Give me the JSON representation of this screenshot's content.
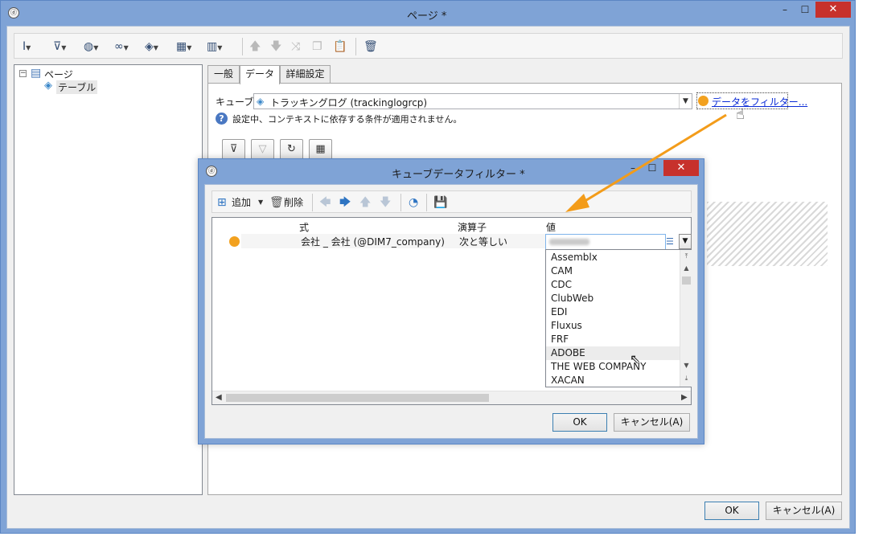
{
  "main_window": {
    "title": "ページ *",
    "logo": "ⓓ",
    "controls": {
      "minimize": "–",
      "maximize": "☐",
      "close": "✕"
    }
  },
  "toolbar": {
    "icons": [
      "insert-icon",
      "filter-add-icon",
      "globe-icon",
      "link-icon",
      "cube-icon",
      "table-icon",
      "columns-icon",
      "move-up-icon",
      "move-down-icon",
      "shuffle-icon",
      "copy-icon",
      "paste-icon",
      "delete-icon"
    ]
  },
  "tree": {
    "root_label": "ページ",
    "child_label": "テーブル",
    "expander": "⊟"
  },
  "tabs": [
    {
      "label": "一般",
      "active": false
    },
    {
      "label": "データ",
      "active": true
    },
    {
      "label": "詳細設定",
      "active": false
    }
  ],
  "data_tab": {
    "cube_label": "キューブ:",
    "cube_value": "トラッキングログ (trackinglogrcp)",
    "filter_link": "データをフィルター...",
    "info_text": "設定中、コンテキストに依存する条件が適用されません。",
    "help_glyph": "?"
  },
  "main_buttons": {
    "ok": "OK",
    "cancel": "キャンセル(A)"
  },
  "dialog": {
    "title": "キューブデータフィルター *",
    "logo": "ⓓ",
    "controls": {
      "minimize": "–",
      "maximize": "☐",
      "close": "✕"
    },
    "toolbar": {
      "add": "追加",
      "delete": "削除"
    },
    "columns": {
      "expression": "式",
      "operator": "演算子",
      "value": "値"
    },
    "row": {
      "expression": "会社 _ 会社 (@DIM7_company)",
      "operator": "次と等しい"
    },
    "options": [
      "Assemblx",
      "CAM",
      "CDC",
      "ClubWeb",
      "EDI",
      "Fluxus",
      "FRF",
      "ADOBE",
      "THE WEB COMPANY",
      "XACAN"
    ],
    "buttons": {
      "ok": "OK",
      "cancel": "キャンセル(A)"
    }
  },
  "colors": {
    "title_bar": "#7fa3d6",
    "accent_orange": "#f39c1a",
    "close_red": "#c7312c",
    "link_blue": "#0a2bd6"
  }
}
